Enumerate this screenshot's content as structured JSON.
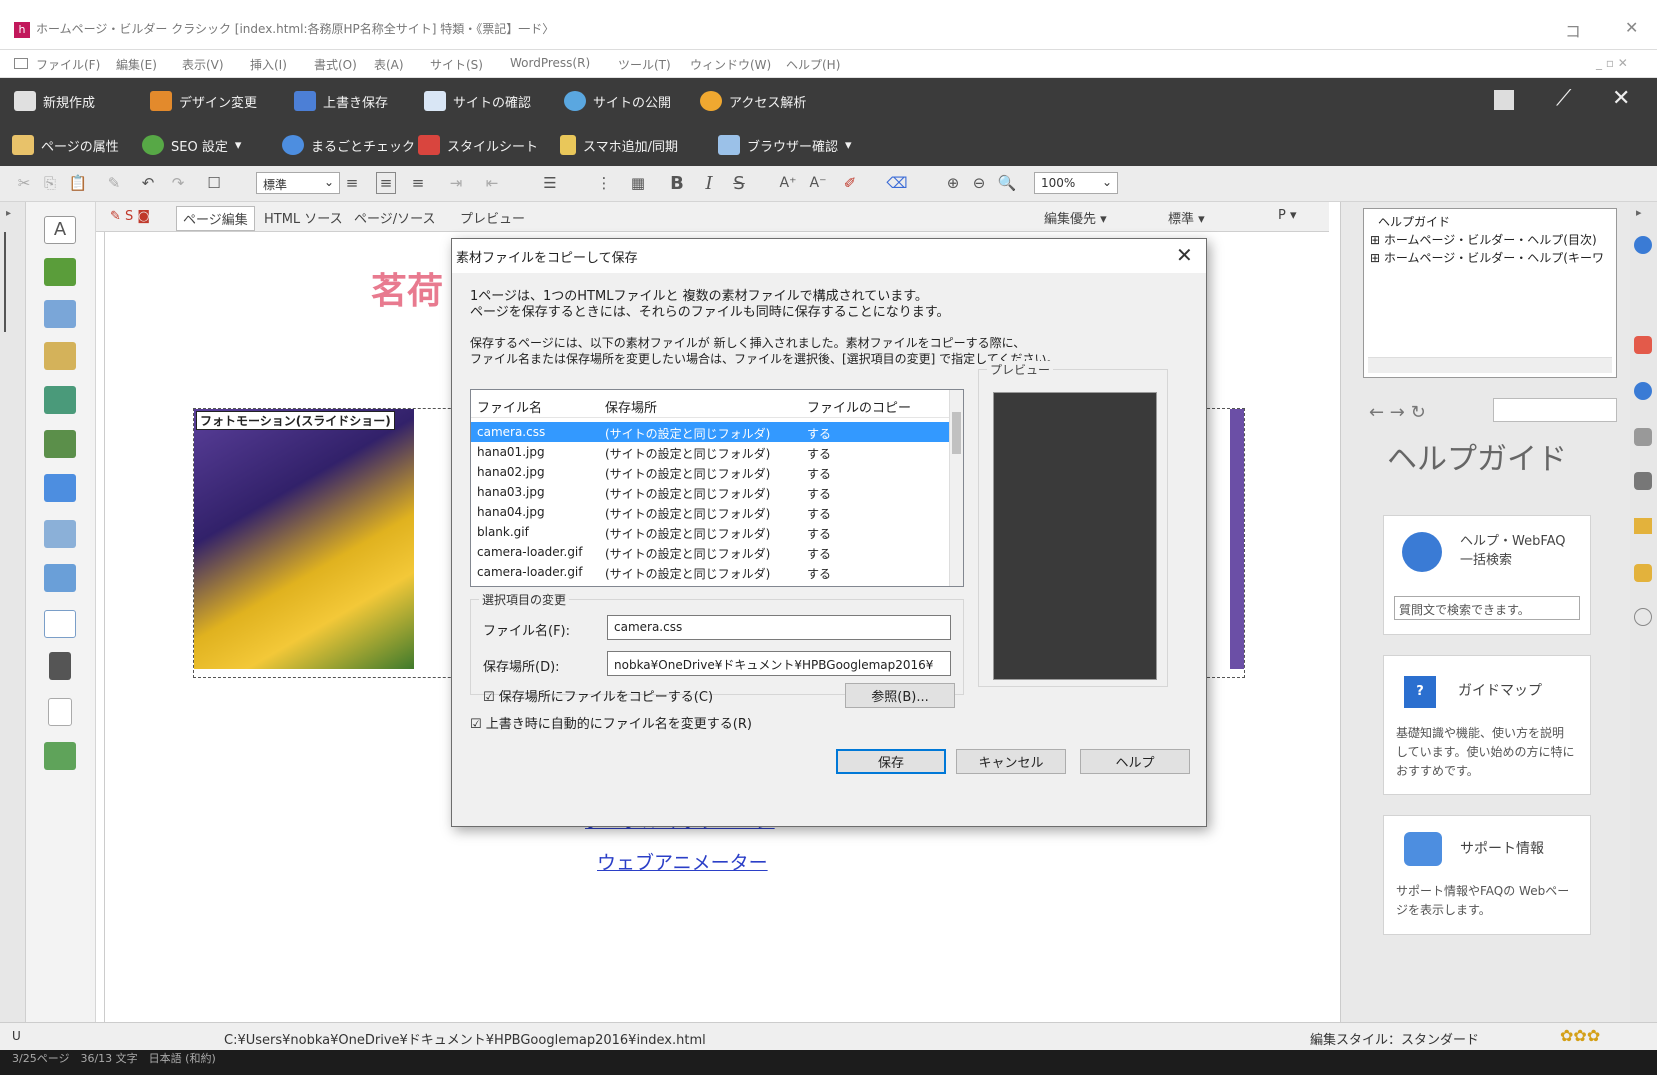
{
  "window": {
    "title": "ホームページ・ビルダー クラシック [index.html:各務原HP名称全サイト] 特類・《票記】一ド〉",
    "minimize": "コ",
    "close": "✕"
  },
  "menu": [
    "ファイル(F)",
    "編集(E)",
    "表示(V)",
    "挿入(I)",
    "書式(O)",
    "表(A)",
    "サイト(S)",
    "WordPress(R)",
    "ツール(T)",
    "ウィンドウ(W)",
    "ヘルプ(H)"
  ],
  "toolbar1": [
    "新規作成",
    "デザイン変更",
    "上書き保存",
    "サイトの確認",
    "サイトの公開",
    "アクセス解析"
  ],
  "toolbar2": [
    "ページの属性",
    "SEO 設定",
    "まるごとチェック",
    "スタイルシート",
    "スマホ追加/同期",
    "ブラウザー確認"
  ],
  "format": {
    "style_combo": "標準",
    "zoom_combo": "100%",
    "bold": "B",
    "italic": "I",
    "strike": "S"
  },
  "editor_tabs": [
    "ページ編集",
    "HTML ソース",
    "ページ/ソース",
    "プレビュー"
  ],
  "editor_options": [
    "編集優先",
    "標準",
    "P"
  ],
  "canvas": {
    "slideshow_label": "フォトモーション(スライドショー)",
    "heading_partial": "茗荷",
    "links": [
      "グーグルマップページ",
      "ウェブアニメーター"
    ]
  },
  "dialog": {
    "title": "素材ファイルをコピーして保存",
    "intro": [
      "1ページは、1つのHTMLファイルと 複数の素材ファイルで構成されています。",
      "ページを保存するときには、それらのファイルも同時に保存することになります。"
    ],
    "notice": [
      "保存するページには、以下の素材ファイルが 新しく挿入されました。素材ファイルをコピーする際に、",
      "ファイル名または保存場所を変更したい場合は、ファイルを選択後、[選択項目の変更] で指定してください。"
    ],
    "columns": [
      "ファイル名",
      "保存場所",
      "ファイルのコピー"
    ],
    "rows": [
      [
        "camera.css",
        "(サイトの設定と同じフォルダ)",
        "する"
      ],
      [
        "hana01.jpg",
        "(サイトの設定と同じフォルダ)",
        "する"
      ],
      [
        "hana02.jpg",
        "(サイトの設定と同じフォルダ)",
        "する"
      ],
      [
        "hana03.jpg",
        "(サイトの設定と同じフォルダ)",
        "する"
      ],
      [
        "hana04.jpg",
        "(サイトの設定と同じフォルダ)",
        "する"
      ],
      [
        "blank.gif",
        "(サイトの設定と同じフォルダ)",
        "する"
      ],
      [
        "camera-loader.gif",
        "(サイトの設定と同じフォルダ)",
        "する"
      ],
      [
        "camera-loader.gif",
        "(サイトの設定と同じフォルダ)",
        "する"
      ]
    ],
    "preview_label": "プレビュー",
    "group_label": "選択項目の変更",
    "filename_label": "ファイル名(F):",
    "filename_value": "camera.css",
    "location_label": "保存場所(D):",
    "location_value": "nobka¥OneDrive¥ドキュメント¥HPBGooglemap2016¥",
    "copy_check_label": "保存場所にファイルをコピーする(C)",
    "browse_button": "参照(B)...",
    "auto_rename_label": "上書き時に自動的にファイル名を変更する(R)",
    "save_button": "保存",
    "cancel_button": "キャンセル",
    "help_button": "ヘルプ"
  },
  "help_panel": {
    "tree": [
      "ヘルプガイド",
      "ホームページ・ビルダー・ヘルプ(目次)",
      "ホームページ・ビルダー・ヘルプ(キーワ"
    ],
    "title": "ヘルプガイド",
    "cards": [
      {
        "title": "ヘルプ・WebFAQ 一括検索",
        "body": "質問文で検索できます。"
      },
      {
        "title": "ガイドマップ",
        "body": "基礎知識や機能、使い方を説明しています。使い始めの方に特におすすめです。"
      },
      {
        "title": "サポート情報",
        "body": "サポート情報やFAQの Webページを表示します。"
      }
    ]
  },
  "status": {
    "path": "C:¥Users¥nobka¥OneDrive¥ドキュメント¥HPBGooglemap2016¥index.html",
    "edit_style": "編集スタイル：スタンダード",
    "left_code": "U",
    "bottom_line": "3/25ページ　36/13 文字　日本語 (和約)"
  },
  "colors": {
    "dark_toolbar": "#3b3b3b",
    "selection": "#3399ff",
    "link": "#2b3fc7"
  }
}
